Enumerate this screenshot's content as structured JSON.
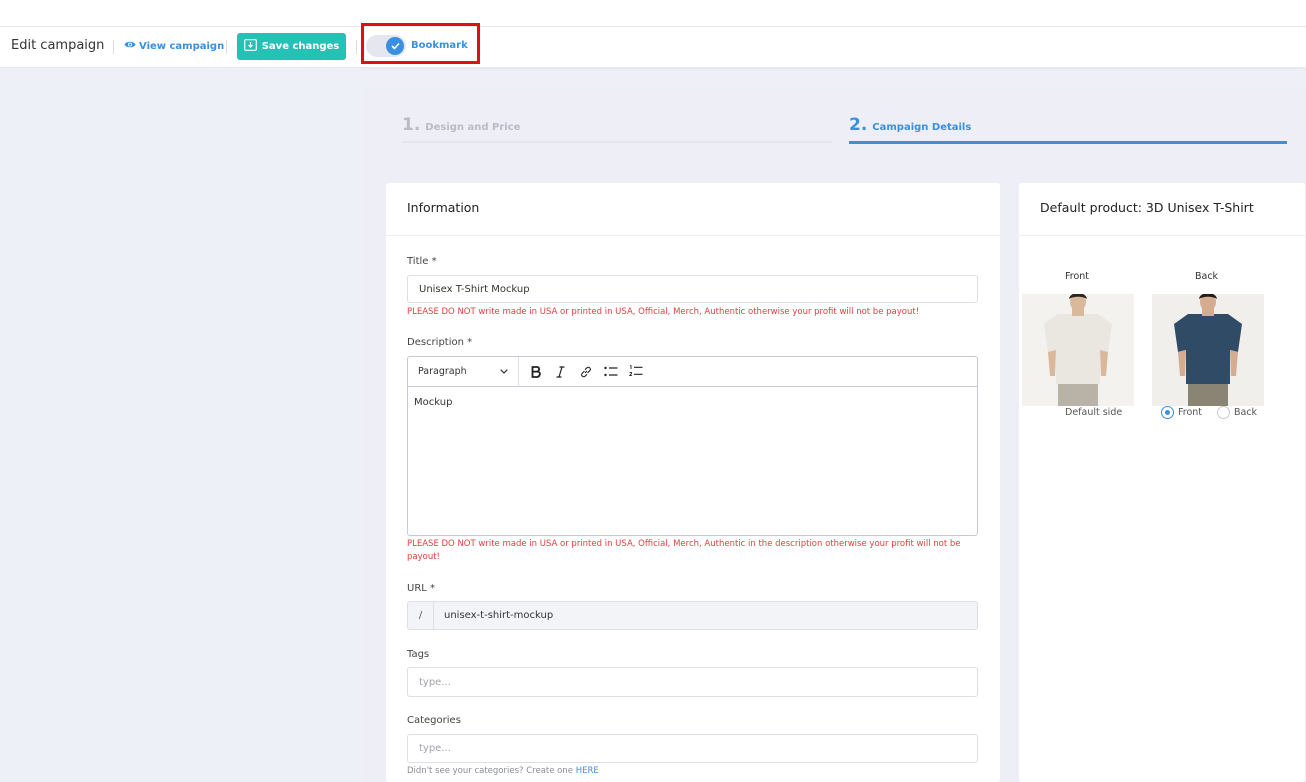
{
  "toolbar": {
    "title": "Edit campaign",
    "view_campaign": "View campaign",
    "save_changes": "Save changes",
    "bookmark": "Bookmark"
  },
  "steps": [
    {
      "num": "1.",
      "label": "Design and Price"
    },
    {
      "num": "2.",
      "label": "Campaign Details"
    }
  ],
  "info": {
    "heading": "Information",
    "title_label": "Title *",
    "title_value": "Unisex T-Shirt Mockup",
    "title_warning": "PLEASE DO NOT write made in USA or printed in USA, Official, Merch, Authentic otherwise your profit will not be payout!",
    "description_label": "Description *",
    "paragraph_select": "Paragraph",
    "description_value": "Mockup",
    "description_warning": "PLEASE DO NOT write made in USA or printed in USA, Official, Merch, Authentic in the description otherwise your profit will not be payout!",
    "url_label": "URL *",
    "url_prefix": "/",
    "url_value": "unisex-t-shirt-mockup",
    "tags_label": "Tags",
    "tags_placeholder": "type...",
    "categories_label": "Categories",
    "categories_placeholder": "type...",
    "categories_hint": "Didn't see your categories? Create one",
    "categories_hint_link": "HERE"
  },
  "product": {
    "heading": "Default product: 3D Unisex T-Shirt",
    "front_label": "Front",
    "back_label": "Back",
    "default_side_label": "Default side",
    "radio_front": "Front",
    "radio_back": "Back",
    "selected_side": "Front",
    "front_shirt_color": "#e9e7df",
    "back_shirt_color": "#2f4b66"
  }
}
